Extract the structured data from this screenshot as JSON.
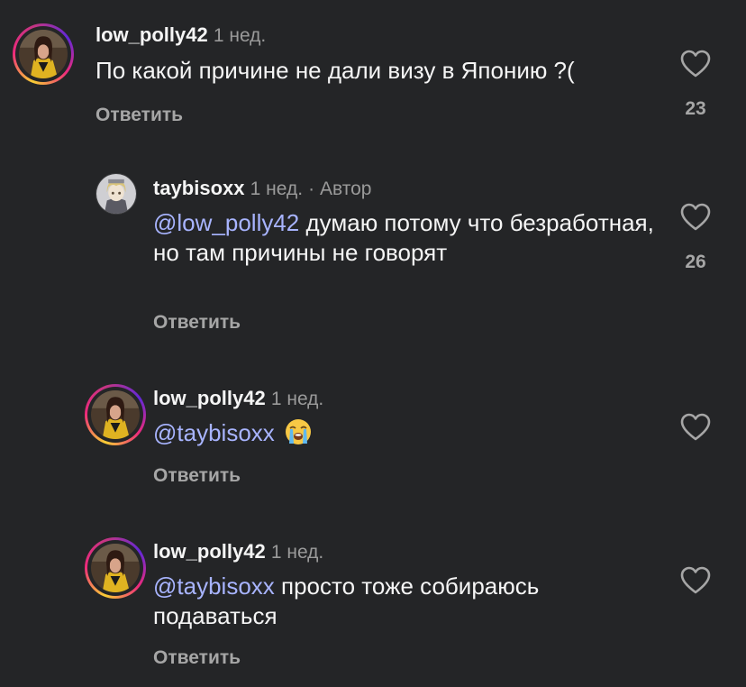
{
  "comments": [
    {
      "username": "low_polly42",
      "time": "1 нед.",
      "author": "",
      "mention": "",
      "text": "По какой причине не дали визу в Японию ?(",
      "reply_label": "Ответить",
      "likes": "23",
      "avatar_icon": "user-avatar-icon"
    },
    {
      "username": "taybisoxx",
      "time": "1 нед.",
      "author": "· Автор",
      "mention": "@low_polly42",
      "text": " думаю потому что безработная, но там причины не говорят",
      "reply_label": "Ответить",
      "likes": "26",
      "avatar_icon": "user-avatar-icon"
    },
    {
      "username": "low_polly42",
      "time": "1 нед.",
      "author": "",
      "mention": "@taybisoxx",
      "text": " ",
      "emoji": "loudly-crying-face-emoji",
      "reply_label": "Ответить",
      "likes": "",
      "avatar_icon": "user-avatar-icon"
    },
    {
      "username": "low_polly42",
      "time": "1 нед.",
      "author": "",
      "mention": "@taybisoxx",
      "text": " просто тоже собираюсь подаваться",
      "reply_label": "Ответить",
      "likes": "",
      "avatar_icon": "user-avatar-icon"
    }
  ],
  "icons": {
    "like": "heart-outline-icon"
  },
  "colors": {
    "background": "#242527",
    "mention": "#a8b4ff",
    "secondary_text": "#9a9a9a"
  }
}
